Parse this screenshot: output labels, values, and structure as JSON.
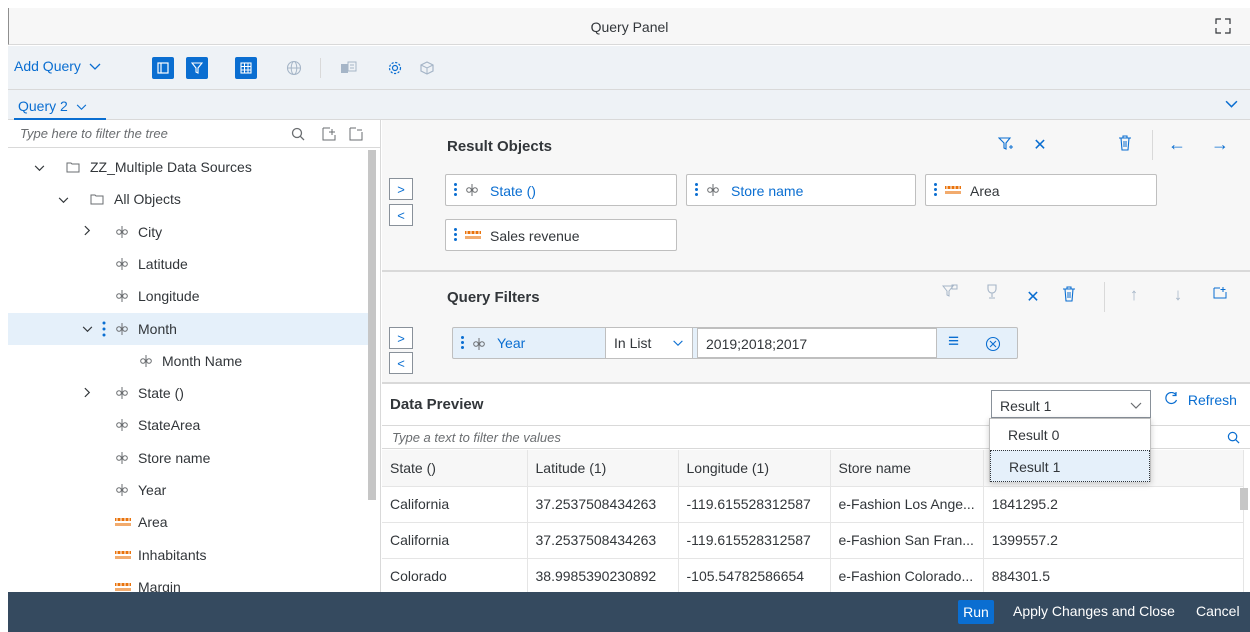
{
  "window": {
    "title": "Query Panel"
  },
  "toolbar": {
    "add_query_label": "Add Query"
  },
  "tabs": {
    "active_label": "Query 2"
  },
  "tree": {
    "filter_placeholder": "Type here to filter the tree",
    "nodes": [
      {
        "label": "ZZ_Multiple Data Sources",
        "icon": "folder-icon",
        "expander": "open"
      },
      {
        "label": "All Objects",
        "icon": "folder-icon",
        "expander": "open"
      },
      {
        "label": "City",
        "icon": "dimension-icon",
        "expander": "closed"
      },
      {
        "label": "Latitude",
        "icon": "dimension-icon",
        "expander": "none"
      },
      {
        "label": "Longitude",
        "icon": "dimension-icon",
        "expander": "none"
      },
      {
        "label": "Month",
        "icon": "dimension-icon",
        "expander": "open",
        "selected": true
      },
      {
        "label": "Month Name",
        "icon": "dimension-icon",
        "expander": "none"
      },
      {
        "label": "State ()",
        "icon": "dimension-icon",
        "expander": "closed"
      },
      {
        "label": "StateArea",
        "icon": "dimension-icon",
        "expander": "none"
      },
      {
        "label": "Store name",
        "icon": "dimension-icon",
        "expander": "none"
      },
      {
        "label": "Year",
        "icon": "dimension-icon",
        "expander": "none"
      },
      {
        "label": "Area",
        "icon": "measure-icon",
        "expander": "none"
      },
      {
        "label": "Inhabitants",
        "icon": "measure-icon",
        "expander": "none"
      },
      {
        "label": "Margin",
        "icon": "measure-icon",
        "expander": "none"
      }
    ]
  },
  "result_objects": {
    "title": "Result Objects",
    "chips": [
      {
        "label": "State ()",
        "icon": "dimension-icon"
      },
      {
        "label": "Store name",
        "icon": "dimension-icon"
      },
      {
        "label": "Area",
        "icon": "measure-icon"
      },
      {
        "label": "Sales revenue",
        "icon": "measure-icon"
      }
    ]
  },
  "query_filters": {
    "title": "Query Filters",
    "filter": {
      "object": "Year",
      "operator": "In List",
      "value": "2019;2018;2017"
    }
  },
  "data_preview": {
    "title": "Data Preview",
    "result_selected": "Result 1",
    "refresh_label": "Refresh",
    "filter_placeholder": "Type a text to filter the values",
    "columns": [
      "State ()",
      "Latitude (1)",
      "Longitude (1)",
      "Store name",
      ""
    ],
    "rows": [
      [
        "California",
        "37.2537508434263",
        "-119.615528312587",
        "e-Fashion Los Ange...",
        "1841295.2"
      ],
      [
        "California",
        "37.2537508434263",
        "-119.615528312587",
        "e-Fashion San Fran...",
        "1399557.2"
      ],
      [
        "Colorado",
        "38.9985390230892",
        "-105.54782586654",
        "e-Fashion Colorado...",
        "884301.5"
      ]
    ],
    "dropdown_options": [
      "Result 0",
      "Result 1"
    ]
  },
  "footer": {
    "run_label": "Run",
    "apply_label": "Apply Changes and Close",
    "cancel_label": "Cancel"
  },
  "colors": {
    "accent": "#0a6ed1",
    "footer": "#354a5f",
    "selection": "#e5f0fa"
  }
}
